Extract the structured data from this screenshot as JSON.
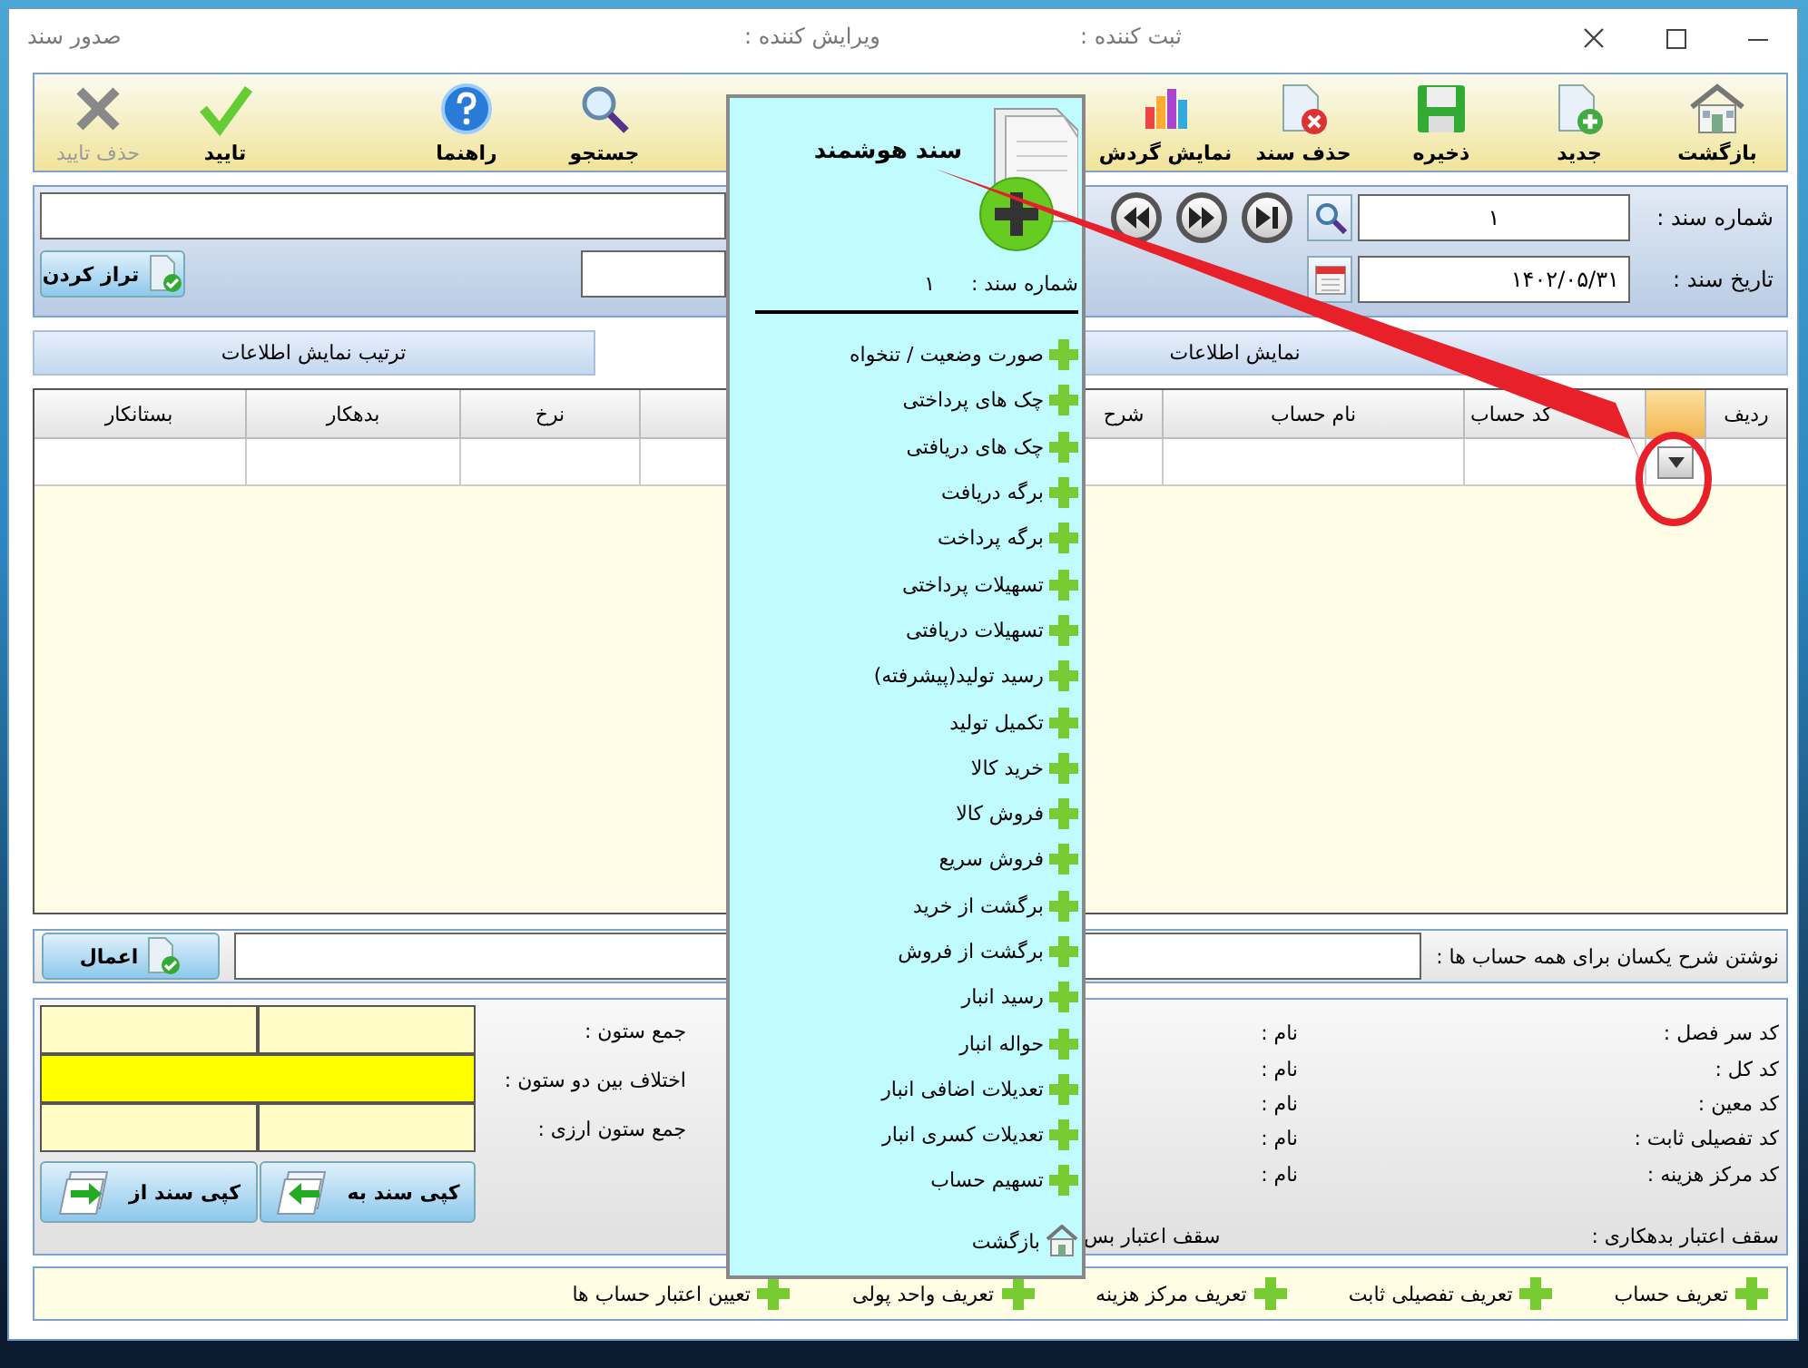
{
  "window": {
    "title": "صدور سند",
    "fields": [
      "ثبت کننده :",
      "ویرایش کننده :"
    ]
  },
  "toolbar": [
    {
      "label": "بازگشت",
      "kind": "house",
      "disabled": false
    },
    {
      "label": "جدید",
      "kind": "new",
      "disabled": false
    },
    {
      "label": "ذخیره",
      "kind": "save",
      "disabled": false
    },
    {
      "label": "حذف سند",
      "kind": "delete",
      "disabled": false
    },
    {
      "label": "نمایش گردش",
      "kind": "chart",
      "disabled": false
    },
    {
      "label": "جستجو",
      "kind": "search",
      "disabled": false
    },
    {
      "label": "راهنما",
      "kind": "help",
      "disabled": false
    },
    {
      "label": "تایید",
      "kind": "check",
      "disabled": false
    },
    {
      "label": "حذف تایید",
      "kind": "cross",
      "disabled": true
    }
  ],
  "header": {
    "doc_number_label": "شماره سند :",
    "doc_number": "۱",
    "date_label": "تاریخ سند :",
    "date": "۱۴۰۲/۰۵/۳۱",
    "balance_button": "تراز کردن"
  },
  "section_tabs": [
    "نمایش اطلاعات",
    "ترتیب نمایش اطلاعات"
  ],
  "table": {
    "columns_right": [
      "ردیف",
      "کد حساب",
      "نام حساب",
      "شرح"
    ],
    "columns_left": [
      "نرخ",
      "بدهکار",
      "بستانکار"
    ]
  },
  "description": {
    "label": "نوشتن شرح یکسان برای همه حساب ها :",
    "apply_button": "اعمال"
  },
  "totals": {
    "labels": [
      "جمع ستون :",
      "اختلاف بین دو ستون :",
      "جمع ستون ارزی :"
    ],
    "copy_buttons": [
      "کپی سند به",
      "کپی سند از"
    ]
  },
  "account_codes": [
    {
      "label": "کد سر فصل :",
      "name_label": "نام :"
    },
    {
      "label": "کد کل :",
      "name_label": "نام :"
    },
    {
      "label": "کد معین :",
      "name_label": "نام :"
    },
    {
      "label": "کد تفصیلی ثابت :",
      "name_label": "نام :"
    },
    {
      "label": "کد مرکز هزینه :",
      "name_label": "نام :"
    }
  ],
  "credit": {
    "debit_limit": "سقف اعتبار بدهکاری :",
    "credit_limit": "سقف اعتبار بس"
  },
  "footer_links": [
    "تعریف حساب",
    "تعریف تفصیلی ثابت",
    "تعریف مرکز هزینه",
    "تعریف واحد پولی",
    "تعیین اعتبار حساب ها"
  ],
  "smart_doc_popup": {
    "title": "سند هوشمند",
    "doc_number_label": "شماره سند :",
    "doc_number": "۱",
    "back": "بازگشت",
    "items": [
      "صورت وضعیت / تنخواه",
      "چک های پرداختی",
      "چک های دریافتی",
      "برگه دریافت",
      "برگه پرداخت",
      "تسهیلات پرداختی",
      "تسهیلات دریافتی",
      "رسید تولید(پیشرفته)",
      "تکمیل تولید",
      "خرید کالا",
      "فروش کالا",
      "فروش سریع",
      "برگشت از خرید",
      "برگشت از فروش",
      "رسید انبار",
      "حواله انبار",
      "تعدیلات اضافی انبار",
      "تعدیلات کسری انبار",
      "تسهیم حساب"
    ]
  }
}
